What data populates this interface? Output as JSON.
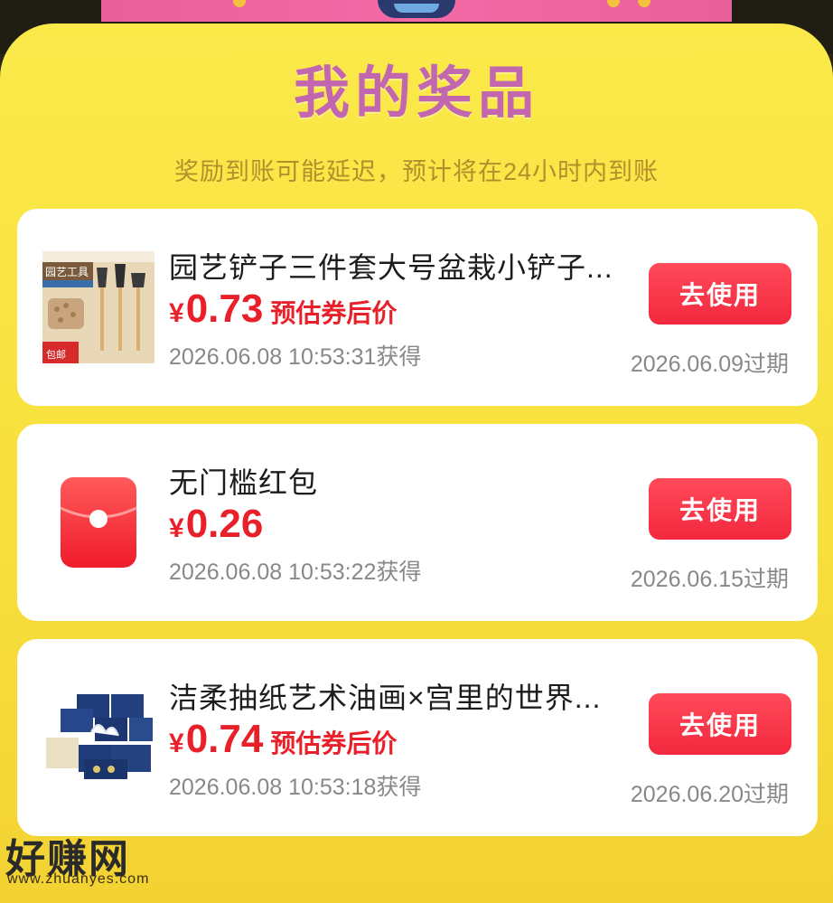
{
  "header": {
    "title": "我的奖品",
    "subtitle": "奖励到账可能延迟，预计将在24小时内到账"
  },
  "prizes": [
    {
      "name": "园艺铲子三件套大号盆栽小铲子...",
      "currency": "¥",
      "price": "0.73",
      "price_note": "预估券后价",
      "obtained": "2026.06.08 10:53:31获得",
      "button_label": "去使用",
      "expire": "2026.06.09过期",
      "thumb_icon": "garden-tools-thumbnail",
      "thumb_texts": [
        "园艺工具",
        "包邮"
      ]
    },
    {
      "name": "无门槛红包",
      "currency": "¥",
      "price": "0.26",
      "price_note": "",
      "obtained": "2026.06.08 10:53:22获得",
      "button_label": "去使用",
      "expire": "2026.06.15过期",
      "thumb_icon": "red-envelope-icon"
    },
    {
      "name": "洁柔抽纸艺术油画×宫里的世界...",
      "currency": "¥",
      "price": "0.74",
      "price_note": "预估券后价",
      "obtained": "2026.06.08 10:53:18获得",
      "button_label": "去使用",
      "expire": "2026.06.20过期",
      "thumb_icon": "tissue-pack-thumbnail"
    }
  ],
  "watermark": {
    "text": "好赚网",
    "url": "www.zhuanyes.com"
  },
  "colors": {
    "accent_red": "#e8202a",
    "title_pink": "#c266b0",
    "panel_yellow": "#f7df3c"
  }
}
